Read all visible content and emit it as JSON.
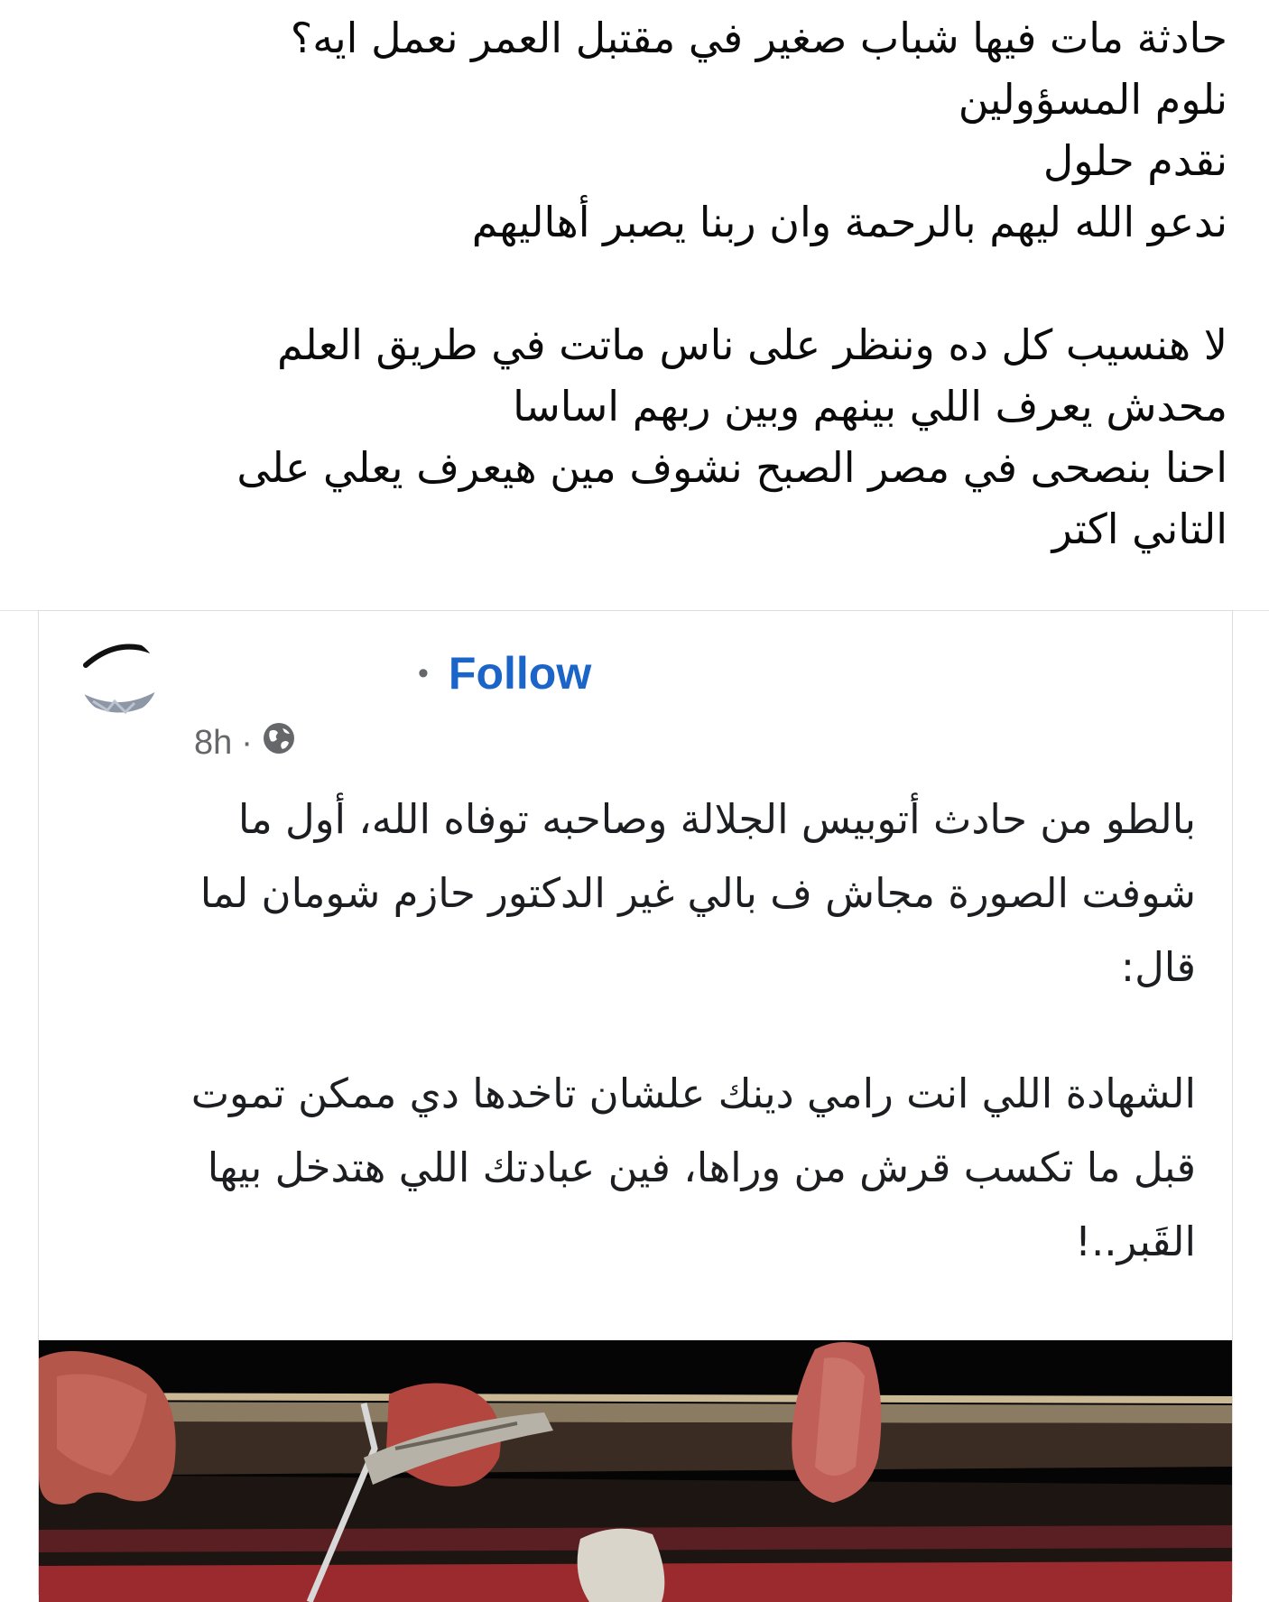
{
  "caption": {
    "lines": [
      "حادثة مات فيها شباب صغير في مقتبل العمر نعمل ايه؟",
      "نلوم المسؤولين",
      "نقدم حلول",
      "ندعو الله ليهم بالرحمة وان ربنا يصبر أهاليهم",
      "لا هنسيب كل ده وننظر على ناس ماتت في طريق العلم",
      "محدش يعرف اللي بينهم وبين ربهم اساسا",
      "احنا بنصحى في مصر الصبح نشوف مين هيعرف يعلي على",
      "التاني اكتر"
    ]
  },
  "shared_post": {
    "separator_dot": "•",
    "follow_label": "Follow",
    "timestamp": "8h",
    "meta_separator": "·",
    "privacy_icon": "globe-icon",
    "body_lines": [
      "بالطو من حادث أتوبيس الجلالة وصاحبه توفاه الله، أول ما",
      "شوفت الصورة مجاش ف بالي غير الدكتور حازم شومان لما",
      "قال:",
      "الشهادة اللي انت رامي دينك علشان تاخدها دي ممكن تموت",
      "قبل ما تكسب قرش من وراها، فين عبادتك اللي هتدخل بيها",
      "القَبر..!"
    ]
  },
  "colors": {
    "follow_blue": "#1b64c8",
    "meta_gray": "#65676b",
    "text": "#1c1e21"
  }
}
